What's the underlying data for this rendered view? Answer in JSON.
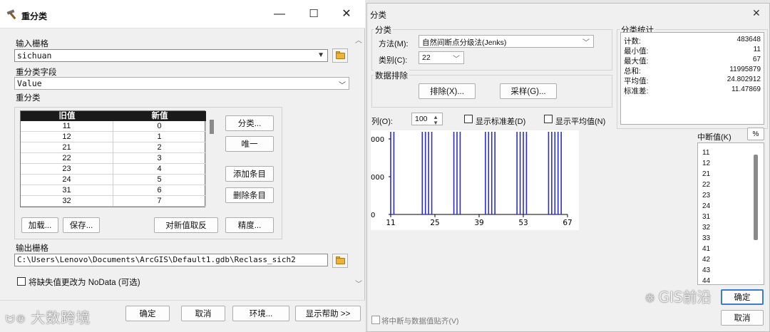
{
  "left_dialog": {
    "title": "重分类",
    "controls": {
      "minimize": "—",
      "maximize": "☐",
      "close": "✕"
    },
    "input_raster_label": "输入栅格",
    "input_raster_value": "sichuan",
    "reclass_field_label": "重分类字段",
    "reclass_field_value": "Value",
    "reclass_label": "重分类",
    "table": {
      "headers": [
        "旧值",
        "新值"
      ],
      "rows": [
        [
          "11",
          "0"
        ],
        [
          "12",
          "1"
        ],
        [
          "21",
          "2"
        ],
        [
          "22",
          "3"
        ],
        [
          "23",
          "4"
        ],
        [
          "24",
          "5"
        ],
        [
          "31",
          "6"
        ],
        [
          "32",
          "7"
        ]
      ]
    },
    "side_buttons": {
      "classify": "分类...",
      "unique": "唯一",
      "add_entry": "添加条目",
      "delete_entry": "删除条目"
    },
    "bottom_buttons": {
      "load": "加载...",
      "save": "保存...",
      "reverse": "对新值取反",
      "precision": "精度..."
    },
    "output_raster_label": "输出栅格",
    "output_raster_value": "C:\\Users\\Lenovo\\Documents\\ArcGIS\\Default1.gdb\\Reclass_sich2",
    "nodata_checkbox_label": "将缺失值更改为 NoData (可选)",
    "footer": {
      "ok": "确定",
      "cancel": "取消",
      "env": "环境...",
      "help": "显示帮助 >>"
    }
  },
  "right_dialog": {
    "title": "分类",
    "close": "✕",
    "classification_group": "分类",
    "method_label": "方法(M):",
    "method_value": "自然间断点分级法(Jenks)",
    "classes_label": "类别(C):",
    "classes_value": "22",
    "exclusion_group": "数据排除",
    "exclusion_button": "排除(X)...",
    "sampling_button": "采样(G)...",
    "stats_group": "分类统计",
    "stats": [
      {
        "key": "计数:",
        "value": "483648"
      },
      {
        "key": "最小值:",
        "value": "11"
      },
      {
        "key": "最大值:",
        "value": "67"
      },
      {
        "key": "总和:",
        "value": "11995879"
      },
      {
        "key": "平均值:",
        "value": "24.802912"
      },
      {
        "key": "标准差:",
        "value": "11.47869"
      }
    ],
    "columns_label": "列(O):",
    "columns_value": "100",
    "show_std_label": "显示标准差(D)",
    "show_mean_label": "显示平均值(N)",
    "breaks_label": "中断值(K)",
    "percent_button": "%",
    "break_values": [
      "11",
      "12",
      "21",
      "22",
      "23",
      "24",
      "31",
      "32",
      "33",
      "41",
      "42",
      "43",
      "44"
    ],
    "snap_label": "将中断与数据值贴齐(V)",
    "ok": "确定",
    "cancel": "取消"
  },
  "chart_data": {
    "type": "bar",
    "x_ticks": [
      11,
      25,
      39,
      53,
      67
    ],
    "y_ticks_visible": [
      "000",
      "000",
      "0"
    ],
    "xlim": [
      11,
      67
    ],
    "break_lines_x": [
      11,
      12,
      21,
      22,
      23,
      24,
      31,
      32,
      33,
      41,
      42,
      43,
      44,
      51,
      52,
      53,
      54,
      61,
      62,
      63,
      64,
      65
    ],
    "bar_color": "#2b2bd6"
  },
  "watermarks": {
    "left": "大数跨境",
    "right": "GIS前沿"
  }
}
